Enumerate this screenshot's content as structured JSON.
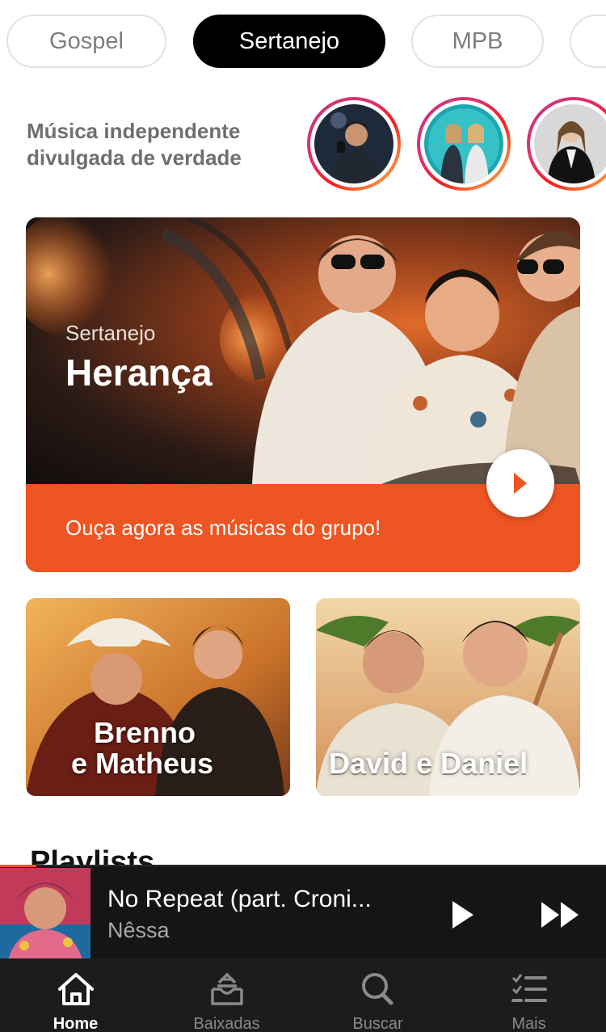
{
  "genres": [
    "Gospel",
    "Sertanejo",
    "MPB"
  ],
  "active_genre": "Sertanejo",
  "stories": {
    "tagline": "Música independente divulgada de verdade"
  },
  "hero": {
    "genre": "Sertanejo",
    "title": "Herança",
    "cta": "Ouça agora as músicas do grupo!"
  },
  "cards": [
    {
      "line1": "Brenno",
      "line2": "e Matheus"
    },
    {
      "line1": "David e Daniel"
    }
  ],
  "section_title": "Playlists",
  "player": {
    "title": "No Repeat (part. Croni...",
    "artist": "Nêssa",
    "progress": 0.06
  },
  "nav": {
    "items": [
      {
        "label": "Home",
        "icon": "home-icon"
      },
      {
        "label": "Baixadas",
        "icon": "download-box-icon"
      },
      {
        "label": "Buscar",
        "icon": "search-icon"
      },
      {
        "label": "Mais",
        "icon": "checklist-icon"
      }
    ],
    "active": "Home"
  },
  "colors": {
    "accent": "#ee5522",
    "active_chip": "#000000",
    "player_bg": "#151515",
    "nav_bg": "#1c1c1c"
  }
}
